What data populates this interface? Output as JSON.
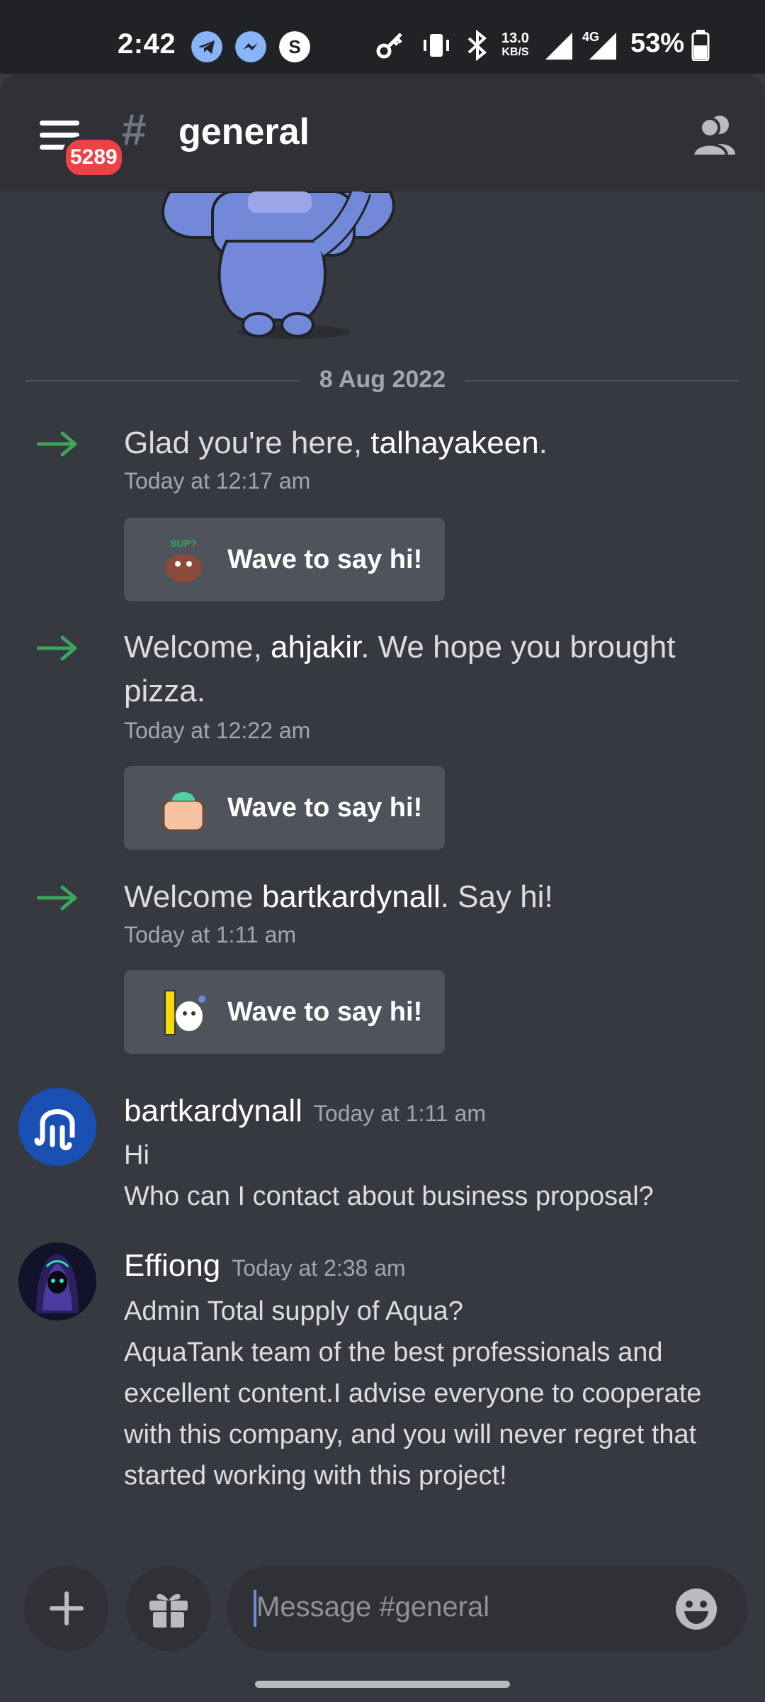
{
  "status_bar": {
    "time": "2:42",
    "network_speed_value": "13.0",
    "network_speed_unit": "KB/S",
    "network_type": "4G",
    "battery": "53%",
    "icons": [
      "telegram-icon",
      "messenger-icon",
      "s-app-icon",
      "vpn-key-icon",
      "vibrate-icon",
      "bluetooth-icon",
      "signal-icon",
      "battery-icon"
    ]
  },
  "header": {
    "notification_badge": "5289",
    "hash": "#",
    "channel_name": "general"
  },
  "chat": {
    "date_divider": "8 Aug 2022",
    "system_messages": [
      {
        "prefix": "Glad you're here, ",
        "user": "talhayakeen",
        "suffix": ".",
        "timestamp": "Today at 12:17 am",
        "wave_label": "Wave to say hi!"
      },
      {
        "prefix": "Welcome, ",
        "user": "ahjakir",
        "suffix": ". We hope you brought pizza.",
        "timestamp": "Today at 12:22 am",
        "wave_label": "Wave to say hi!"
      },
      {
        "prefix": "Welcome ",
        "user": "bartkardynall",
        "suffix": ". Say hi!",
        "timestamp": "Today at 1:11 am",
        "wave_label": "Wave to say hi!"
      }
    ],
    "messages": [
      {
        "author": "bartkardynall",
        "timestamp": "Today at 1:11 am",
        "lines": [
          "Hi",
          "Who can I contact about business proposal?"
        ]
      },
      {
        "author": "Effiong",
        "timestamp": "Today at 2:38 am",
        "lines": [
          "Admin Total supply of Aqua?",
          "AquaTank team of the best professionals and",
          "excellent content.I advise everyone to cooperate",
          "with this company, and you will never regret that",
          "started working with this project!"
        ]
      }
    ]
  },
  "composer": {
    "placeholder": "Message #general"
  },
  "colors": {
    "background": "#36393f",
    "header": "#2f3136",
    "accent_green": "#3ba55c",
    "badge_red": "#ed4245",
    "button": "#4f545c"
  }
}
